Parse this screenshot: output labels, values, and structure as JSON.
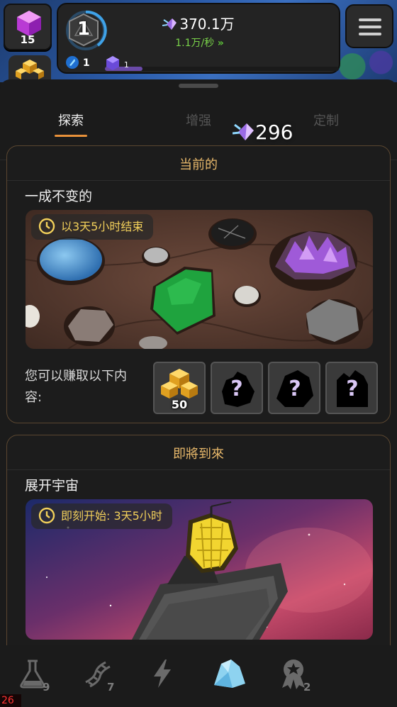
{
  "hud": {
    "cube_count": "15",
    "level": "1",
    "gem_amount": "370.1万",
    "gem_rate": "1.1万/秒",
    "resource_blue": "1",
    "resource_purple": "1",
    "resource_purple_progress": 0.16
  },
  "tabs": [
    {
      "label": "探索",
      "active": true
    },
    {
      "label": "增强",
      "active": false
    },
    {
      "label": "定制",
      "active": false
    }
  ],
  "floating_gem_count": "296",
  "current_event": {
    "header": "当前的",
    "title": "一成不变的",
    "timer": "以3天5小时结束",
    "earn_label": "您可以赚取以下内容:",
    "rewards": [
      {
        "type": "gold-cubes",
        "quantity": "50"
      },
      {
        "type": "mystery",
        "quantity": ""
      },
      {
        "type": "mystery",
        "quantity": ""
      },
      {
        "type": "mystery",
        "quantity": ""
      }
    ]
  },
  "upcoming_event": {
    "header": "即將到來",
    "title": "展开宇宙",
    "timer": "即刻开始: 3天5小时"
  },
  "nav": [
    {
      "icon": "flask-icon",
      "badge": "9"
    },
    {
      "icon": "dna-icon",
      "badge": "7"
    },
    {
      "icon": "lightning-icon",
      "badge": ""
    },
    {
      "icon": "rock-icon",
      "badge": "",
      "active": true
    },
    {
      "icon": "medal-icon",
      "badge": "2"
    }
  ],
  "corner_counter": "26",
  "colors": {
    "accent": "#e8913a",
    "header_gold": "#e9b96b",
    "timer_yellow": "#f2d05a",
    "rate_green": "#7ad34a"
  }
}
